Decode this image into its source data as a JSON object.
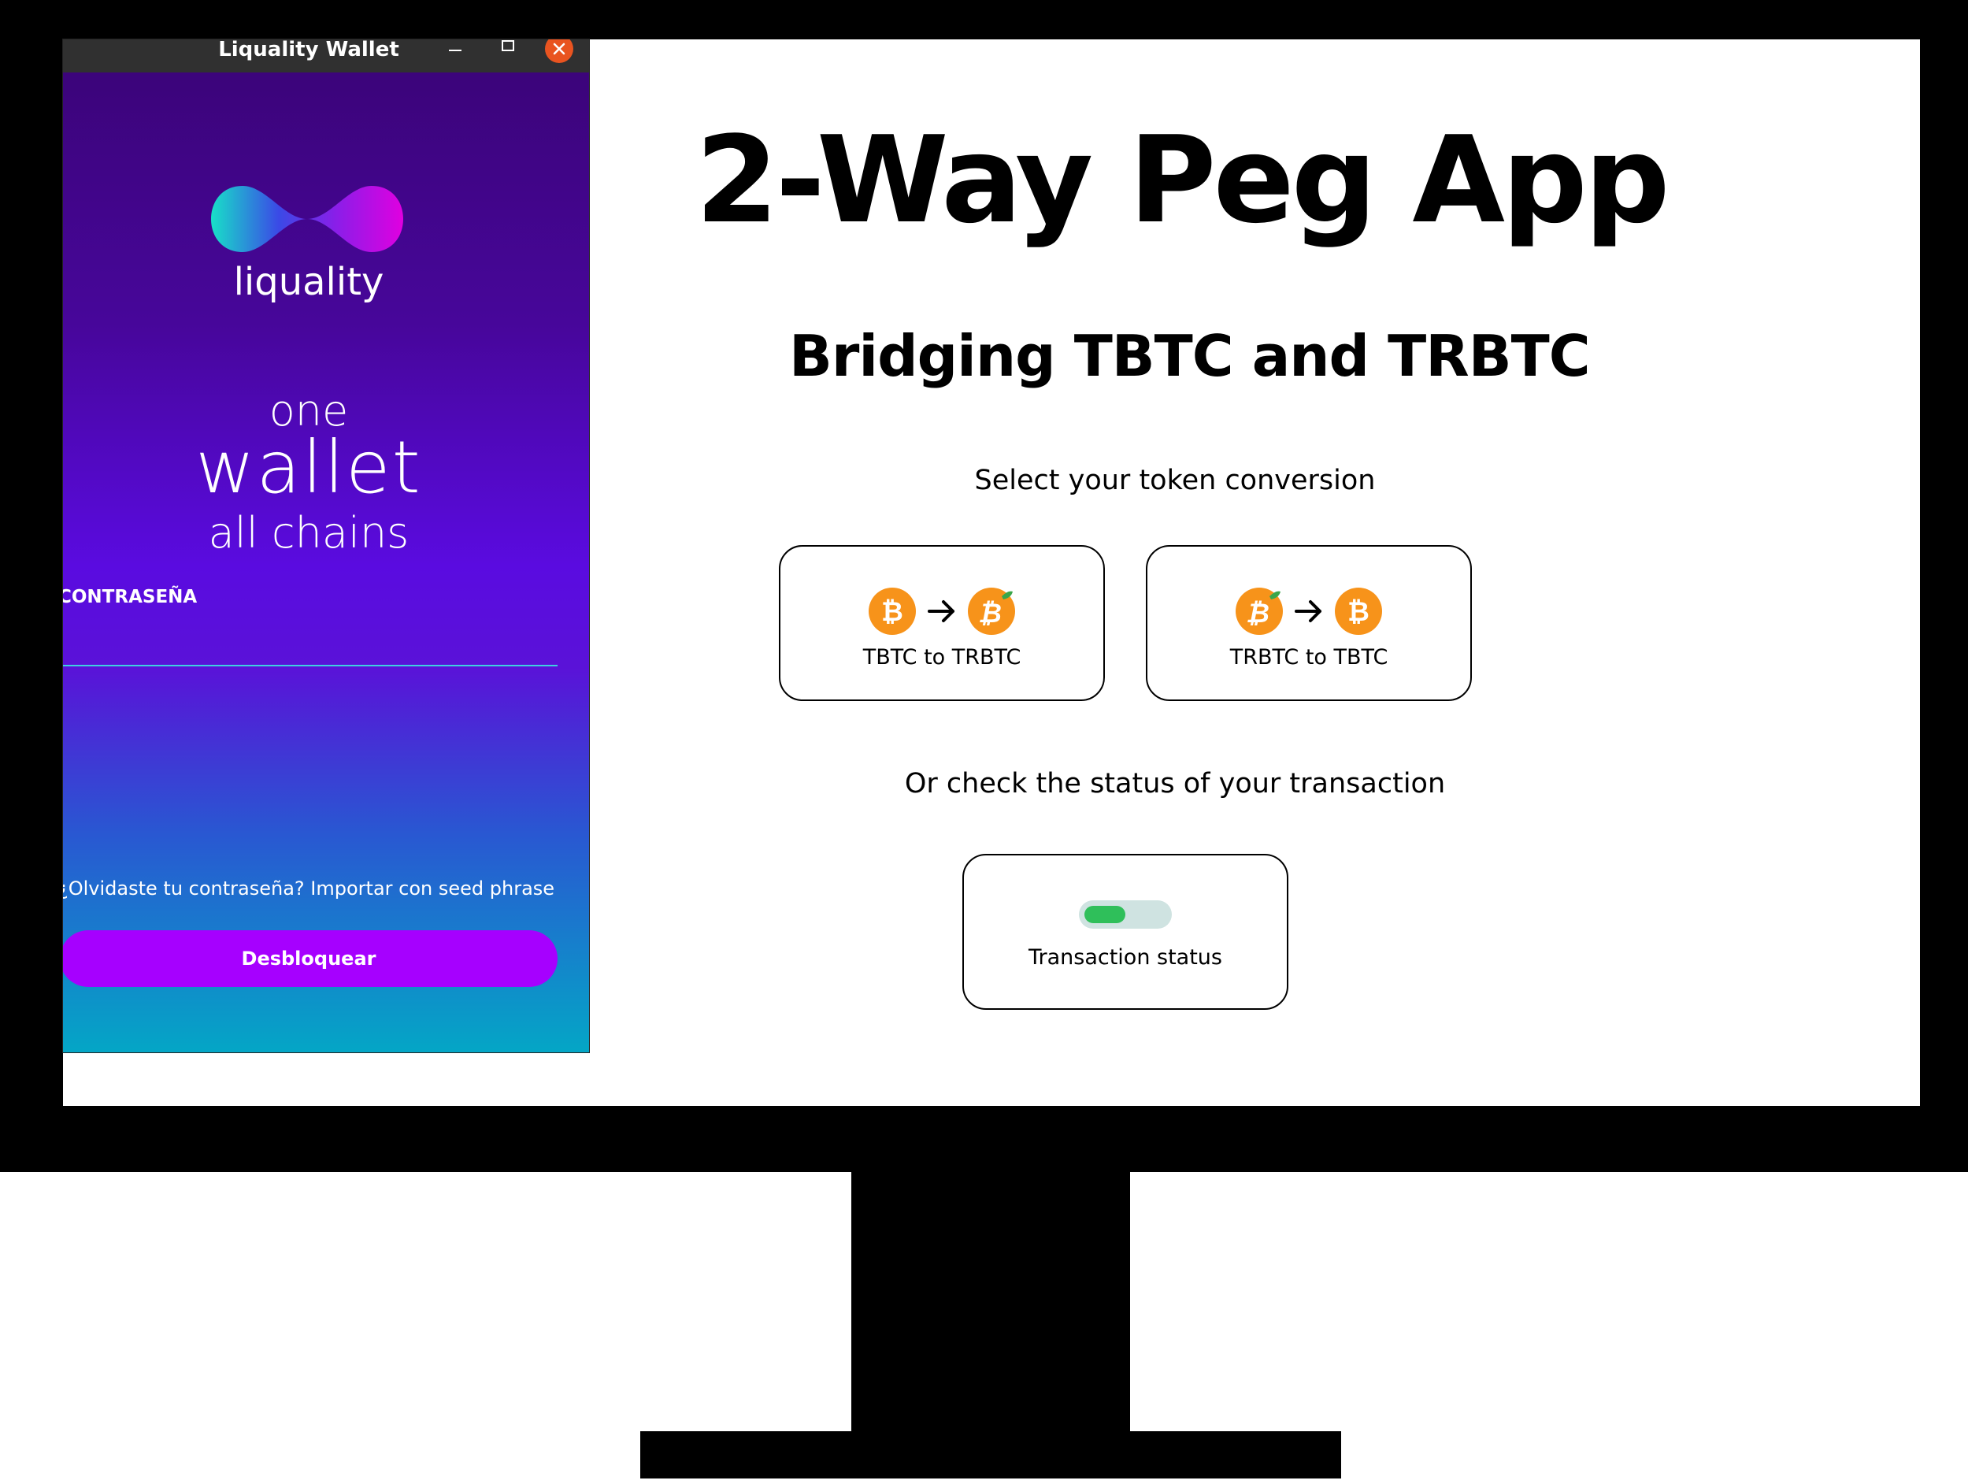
{
  "app": {
    "title": "2-Way Peg App",
    "subtitle": "Bridging TBTC and TRBTC",
    "select_label": "Select your token conversion",
    "status_prompt": "Or check the status of your transaction",
    "cards": [
      {
        "label": "TBTC to TRBTC",
        "from_icon": "bitcoin-icon",
        "to_icon": "rsk-bitcoin-icon"
      },
      {
        "label": "TRBTC to TBTC",
        "from_icon": "rsk-bitcoin-icon",
        "to_icon": "bitcoin-icon"
      }
    ],
    "status_card": {
      "label": "Transaction status",
      "icon": "toggle-icon"
    }
  },
  "wallet": {
    "window_title": "Liquality Wallet",
    "brand_name": "liquality",
    "tagline": {
      "one": "one",
      "wallet": "wallet",
      "chains": "all chains"
    },
    "password_label": "CONTRASEÑA",
    "password_value": "",
    "forgot_text": "¿Olvidaste tu contraseña? Importar con seed phrase",
    "unlock_label": "Desbloquear"
  },
  "colors": {
    "bitcoin_orange": "#f7931a",
    "unlock_purple": "#a600ff",
    "status_green": "#2fbf5a",
    "close_orange": "#e95420"
  }
}
